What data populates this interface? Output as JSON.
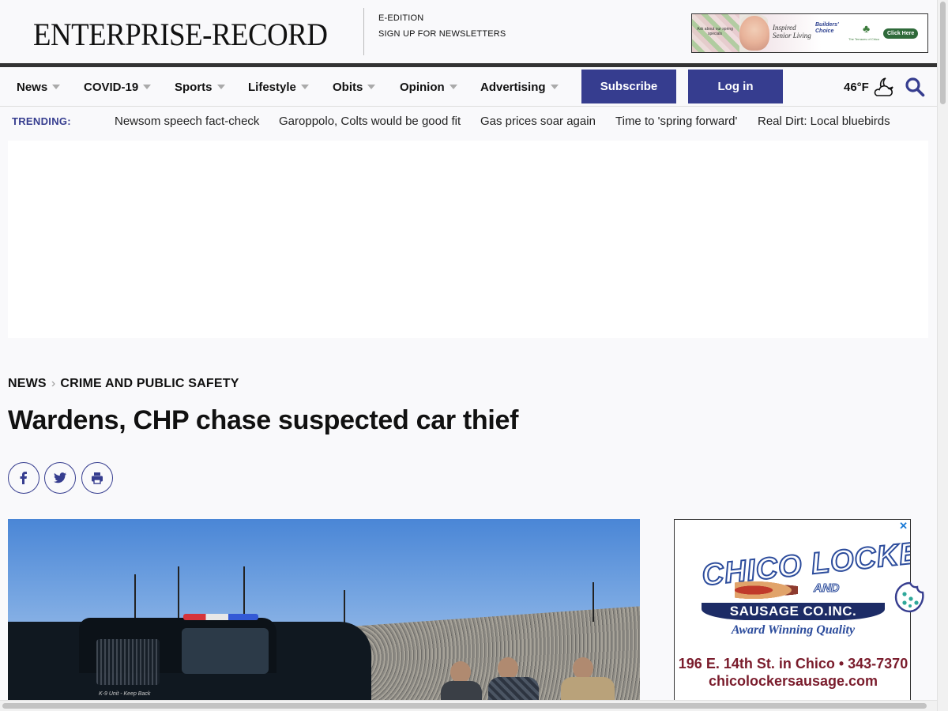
{
  "header": {
    "masthead": "ENTERPRISE-RECORD",
    "links": [
      "E-EDITION",
      "SIGN UP FOR NEWSLETTERS"
    ],
    "ad": {
      "small_text": "Ask about our spring specials",
      "text": "Inspired Senior Living",
      "badge": "Builders' Choice",
      "brand": "The Terraces of Chico",
      "cta": "Click Here"
    }
  },
  "nav": {
    "items": [
      "News",
      "COVID-19",
      "Sports",
      "Lifestyle",
      "Obits",
      "Opinion",
      "Advertising"
    ],
    "subscribe_label": "Subscribe",
    "login_label": "Log in",
    "temperature": "46°F",
    "weather_icon": "partly-cloudy-night-icon",
    "search_icon": "search-icon"
  },
  "trending": {
    "label": "TRENDING:",
    "links": [
      "Newsom speech fact-check",
      "Garoppolo, Colts would be good fit",
      "Gas prices soar again",
      "Time to 'spring forward'",
      "Real Dirt: Local bluebirds"
    ]
  },
  "article": {
    "breadcrumb": [
      "NEWS",
      "CRIME AND PUBLIC SAFETY"
    ],
    "headline": "Wardens, CHP chase suspected car thief",
    "share_icons": [
      "facebook-icon",
      "twitter-icon",
      "print-icon"
    ],
    "photo_text": "K-9 Unit - Keep Back"
  },
  "right_ad": {
    "close": "✕",
    "logo_line1": "CHICO LOCKER",
    "logo_and": "AND",
    "banner": "SAUSAGE CO.INC.",
    "tagline": "Award Winning Quality",
    "address": "196 E. 14th St. in Chico • 343-7370",
    "website": "chicolockersausage.com"
  },
  "colors": {
    "brand_blue": "#363d8f",
    "ad_text_red": "#7a1c2c",
    "ad_logo_blue": "#2c4c9c"
  }
}
